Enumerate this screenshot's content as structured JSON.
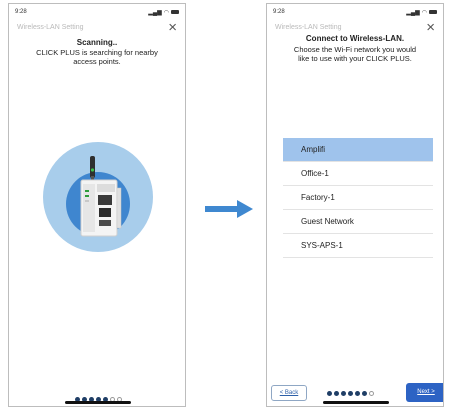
{
  "colors": {
    "accent": "#2d63c4",
    "selected_row": "#9fc3ec",
    "circle_outer": "#a8cdeb",
    "circle_inner": "#3f86cf",
    "arrow": "#3f88d0"
  },
  "arrow_icon": "right-arrow-icon",
  "left_screen": {
    "status": {
      "time": "9:28"
    },
    "header_title": "Wireless-LAN Setting",
    "heading": "Scanning..",
    "message_line1": "CLICK PLUS is searching for nearby",
    "message_line2": "access points.",
    "illustration": "click-plus-device-icon",
    "page_dots": {
      "filled": 5,
      "total": 7
    }
  },
  "right_screen": {
    "status": {
      "time": "9:28"
    },
    "header_title": "Wireless-LAN Setting",
    "heading": "Connect to Wireless-LAN.",
    "message_line1": "Choose the Wi-Fi network you would",
    "message_line2": "like to use with your CLICK PLUS.",
    "networks": [
      "Amplifi",
      "Office-1",
      "Factory-1",
      "Guest Network",
      "SYS-APS-1"
    ],
    "selected_network": "Amplifi",
    "page_dots": {
      "filled": 6,
      "total": 7
    },
    "back_label": "< Back",
    "next_label": "Next >"
  }
}
